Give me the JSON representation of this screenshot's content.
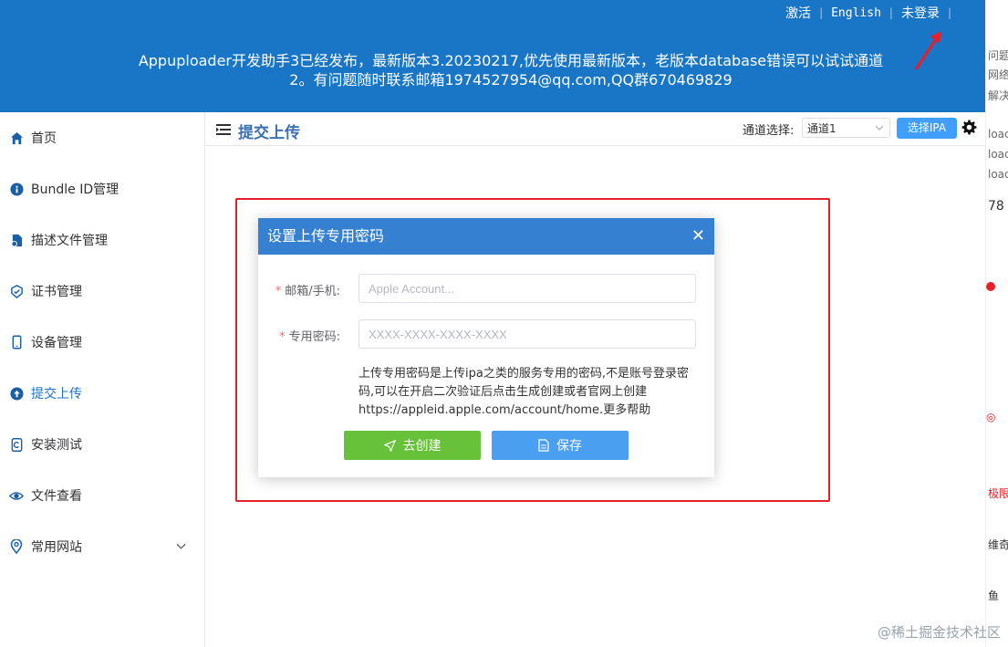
{
  "header": {
    "activate": "激活",
    "english": "English",
    "login": "未登录",
    "notice": "Appuploader开发助手3已经发布，最新版本3.20230217,优先使用最新版本，老版本database错误可以试试通道2。有问题随时联系邮箱1974527954@qq.com,QQ群670469829"
  },
  "sidebar": {
    "items": [
      {
        "label": "首页",
        "icon": "home-icon"
      },
      {
        "label": "Bundle ID管理",
        "icon": "info-icon"
      },
      {
        "label": "描述文件管理",
        "icon": "file-icon"
      },
      {
        "label": "证书管理",
        "icon": "certificate-icon"
      },
      {
        "label": "设备管理",
        "icon": "phone-icon"
      },
      {
        "label": "提交上传",
        "icon": "upload-icon",
        "active": true
      },
      {
        "label": "安装测试",
        "icon": "install-icon"
      },
      {
        "label": "文件查看",
        "icon": "eye-icon"
      },
      {
        "label": "常用网站",
        "icon": "location-icon"
      }
    ]
  },
  "content": {
    "title": "提交上传",
    "channel_label": "通道选择:",
    "channel_value": "通道1",
    "choose_ipa": "选择IPA"
  },
  "dialog": {
    "title": "设置上传专用密码",
    "email_label": "邮箱/手机:",
    "email_placeholder": "Apple Account...",
    "password_label": "专用密码:",
    "password_placeholder": "XXXX-XXXX-XXXX-XXXX",
    "help_text": "上传专用密码是上传ipa之类的服务专用的密码,不是账号登录密码,可以在开启二次验证后点击生成创建或者官网上创建https://appleid.apple.com/account/home.更多帮助",
    "create_label": "去创建",
    "save_label": "保存"
  },
  "right_strip": [
    "问题",
    "网络",
    "解决",
    "loac",
    "loac",
    "loac",
    "78",
    "极限",
    "维奇",
    "鱼"
  ],
  "watermark": "@稀土掘金技术社区",
  "colors": {
    "banner": "#1976c6",
    "accent": "#409eff",
    "green": "#67c23a",
    "highlight": "#e5202a"
  }
}
